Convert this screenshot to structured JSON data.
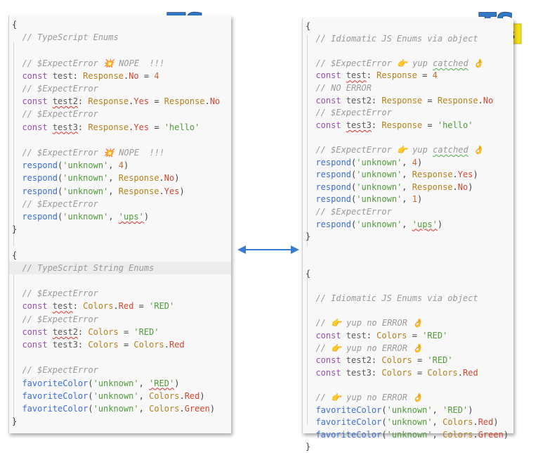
{
  "logos": {
    "ts": "TS",
    "tsjs_ts": "TS",
    "tsjs_js": "JS"
  },
  "left_panel": {
    "lines": [
      [
        [
          "pl",
          "{"
        ]
      ],
      [
        [
          "cm",
          "  // TypeScript Enums"
        ]
      ],
      [],
      [
        [
          "cm",
          "  // $ExpectError 💥 NOPE  !!!"
        ]
      ],
      [
        [
          "kw",
          "  const "
        ],
        [
          "vr",
          "test"
        ],
        [
          "pl",
          ": "
        ],
        [
          "ty",
          "Response"
        ],
        [
          "pl",
          "."
        ],
        [
          "pr",
          "No"
        ],
        [
          "pl",
          " = "
        ],
        [
          "nu",
          "4"
        ]
      ],
      [
        [
          "cm",
          "  // $ExpectError"
        ]
      ],
      [
        [
          "kw",
          "  const "
        ],
        [
          "vr sq",
          "test2"
        ],
        [
          "pl",
          ": "
        ],
        [
          "ty",
          "Response"
        ],
        [
          "pl",
          "."
        ],
        [
          "pr",
          "Yes"
        ],
        [
          "pl",
          " = "
        ],
        [
          "ty",
          "Response"
        ],
        [
          "pl",
          "."
        ],
        [
          "pr",
          "No"
        ]
      ],
      [
        [
          "cm",
          "  // $ExpectError"
        ]
      ],
      [
        [
          "kw",
          "  const "
        ],
        [
          "vr sq",
          "test3"
        ],
        [
          "pl",
          ": "
        ],
        [
          "ty",
          "Response"
        ],
        [
          "pl",
          "."
        ],
        [
          "pr",
          "Yes"
        ],
        [
          "pl",
          " = "
        ],
        [
          "st",
          "'hello'"
        ]
      ],
      [],
      [
        [
          "cm",
          "  // $ExpectError 💥 NOPE  !!!"
        ]
      ],
      [
        [
          "fn",
          "  respond"
        ],
        [
          "pl",
          "("
        ],
        [
          "st",
          "'unknown'"
        ],
        [
          "pl",
          ", "
        ],
        [
          "nu",
          "4"
        ],
        [
          "pl",
          ")"
        ]
      ],
      [
        [
          "fn",
          "  respond"
        ],
        [
          "pl",
          "("
        ],
        [
          "st",
          "'unknown'"
        ],
        [
          "pl",
          ", "
        ],
        [
          "ty",
          "Response"
        ],
        [
          "pl",
          "."
        ],
        [
          "pr",
          "No"
        ],
        [
          "pl",
          ")"
        ]
      ],
      [
        [
          "fn",
          "  respond"
        ],
        [
          "pl",
          "("
        ],
        [
          "st",
          "'unknown'"
        ],
        [
          "pl",
          ", "
        ],
        [
          "ty",
          "Response"
        ],
        [
          "pl",
          "."
        ],
        [
          "pr",
          "Yes"
        ],
        [
          "pl",
          ")"
        ]
      ],
      [
        [
          "cm",
          "  // $ExpectError"
        ]
      ],
      [
        [
          "fn",
          "  respond"
        ],
        [
          "pl",
          "("
        ],
        [
          "st",
          "'unknown'"
        ],
        [
          "pl",
          ", "
        ],
        [
          "st sq",
          "'ups'"
        ],
        [
          "pl",
          ")"
        ]
      ],
      [
        [
          "pl",
          "}"
        ]
      ],
      [],
      [
        [
          "pl",
          "{"
        ]
      ],
      [
        [
          "cm",
          "  // TypeScript String Enums"
        ]
      ],
      [],
      [
        [
          "cm",
          "  // $ExpectError"
        ]
      ],
      [
        [
          "kw",
          "  const "
        ],
        [
          "vr sq",
          "test"
        ],
        [
          "pl",
          ": "
        ],
        [
          "ty",
          "Colors"
        ],
        [
          "pl",
          "."
        ],
        [
          "pr",
          "Red"
        ],
        [
          "pl",
          " = "
        ],
        [
          "st",
          "'RED'"
        ]
      ],
      [
        [
          "cm",
          "  // $ExpectError"
        ]
      ],
      [
        [
          "kw",
          "  const "
        ],
        [
          "vr sq",
          "test2"
        ],
        [
          "pl",
          ": "
        ],
        [
          "ty",
          "Colors"
        ],
        [
          "pl",
          " = "
        ],
        [
          "st",
          "'RED'"
        ]
      ],
      [
        [
          "kw",
          "  const "
        ],
        [
          "vr",
          "test3"
        ],
        [
          "pl",
          ": "
        ],
        [
          "ty",
          "Colors"
        ],
        [
          "pl",
          " = "
        ],
        [
          "ty",
          "Colors"
        ],
        [
          "pl",
          "."
        ],
        [
          "pr",
          "Red"
        ]
      ],
      [],
      [
        [
          "cm",
          "  // $ExpectError"
        ]
      ],
      [
        [
          "fn",
          "  favoriteColor"
        ],
        [
          "pl",
          "("
        ],
        [
          "st",
          "'unknown'"
        ],
        [
          "pl",
          ", "
        ],
        [
          "st sq",
          "'RED'"
        ],
        [
          "pl",
          ")"
        ]
      ],
      [
        [
          "fn",
          "  favoriteColor"
        ],
        [
          "pl",
          "("
        ],
        [
          "st",
          "'unknown'"
        ],
        [
          "pl",
          ", "
        ],
        [
          "ty",
          "Colors"
        ],
        [
          "pl",
          "."
        ],
        [
          "pr",
          "Red"
        ],
        [
          "pl",
          ")"
        ]
      ],
      [
        [
          "fn",
          "  favoriteColor"
        ],
        [
          "pl",
          "("
        ],
        [
          "st",
          "'unknown'"
        ],
        [
          "pl",
          ", "
        ],
        [
          "ty",
          "Colors"
        ],
        [
          "pl",
          "."
        ],
        [
          "pr",
          "Green"
        ],
        [
          "pl",
          ")"
        ]
      ],
      [
        [
          "pl",
          "}"
        ]
      ]
    ]
  },
  "right_panel": {
    "lines": [
      [
        [
          "pl",
          "{"
        ]
      ],
      [
        [
          "cm",
          "  // Idiomatic JS Enums via object"
        ]
      ],
      [],
      [
        [
          "cm",
          "  // $ExpectError 👉 yup "
        ],
        [
          "cm sqg",
          "catched"
        ],
        [
          "cm",
          " 👌"
        ]
      ],
      [
        [
          "kw",
          "  const "
        ],
        [
          "vr sq",
          "test"
        ],
        [
          "pl",
          ": "
        ],
        [
          "ty",
          "Response"
        ],
        [
          "pl",
          " = "
        ],
        [
          "nu",
          "4"
        ]
      ],
      [
        [
          "cm",
          "  // NO ERROR"
        ]
      ],
      [
        [
          "kw",
          "  const "
        ],
        [
          "vr",
          "test2"
        ],
        [
          "pl",
          ": "
        ],
        [
          "ty",
          "Response"
        ],
        [
          "pl",
          " = "
        ],
        [
          "ty",
          "Response"
        ],
        [
          "pl",
          "."
        ],
        [
          "pr",
          "No"
        ]
      ],
      [
        [
          "cm",
          "  // $ExpectError"
        ]
      ],
      [
        [
          "kw",
          "  const "
        ],
        [
          "vr sq",
          "test3"
        ],
        [
          "pl",
          ": "
        ],
        [
          "ty",
          "Response"
        ],
        [
          "pl",
          " = "
        ],
        [
          "st",
          "'hello'"
        ]
      ],
      [],
      [
        [
          "cm",
          "  // $ExpectError 👉 yup "
        ],
        [
          "cm sqg",
          "catched"
        ],
        [
          "cm",
          " 👌"
        ]
      ],
      [
        [
          "fn",
          "  respond"
        ],
        [
          "pl",
          "("
        ],
        [
          "st",
          "'unknown'"
        ],
        [
          "pl",
          ", "
        ],
        [
          "nu",
          "4"
        ],
        [
          "pl",
          ")"
        ]
      ],
      [
        [
          "fn",
          "  respond"
        ],
        [
          "pl",
          "("
        ],
        [
          "st",
          "'unknown'"
        ],
        [
          "pl",
          ", "
        ],
        [
          "ty",
          "Response"
        ],
        [
          "pl",
          "."
        ],
        [
          "pr",
          "Yes"
        ],
        [
          "pl",
          ")"
        ]
      ],
      [
        [
          "fn",
          "  respond"
        ],
        [
          "pl",
          "("
        ],
        [
          "st",
          "'unknown'"
        ],
        [
          "pl",
          ", "
        ],
        [
          "ty",
          "Response"
        ],
        [
          "pl",
          "."
        ],
        [
          "pr",
          "No"
        ],
        [
          "pl",
          ")"
        ]
      ],
      [
        [
          "fn",
          "  respond"
        ],
        [
          "pl",
          "("
        ],
        [
          "st",
          "'unknown'"
        ],
        [
          "pl",
          ", "
        ],
        [
          "nu",
          "1"
        ],
        [
          "pl",
          ")"
        ]
      ],
      [
        [
          "cm",
          "  // $ExpectError"
        ]
      ],
      [
        [
          "fn",
          "  respond"
        ],
        [
          "pl",
          "("
        ],
        [
          "st",
          "'unknown'"
        ],
        [
          "pl",
          ", "
        ],
        [
          "st sq",
          "'ups'"
        ],
        [
          "pl",
          ")"
        ]
      ],
      [
        [
          "pl",
          "}"
        ]
      ],
      [],
      [],
      [
        [
          "pl",
          "{"
        ]
      ],
      [],
      [
        [
          "cm",
          "  // Idiomatic JS Enums via object"
        ]
      ],
      [],
      [
        [
          "cm",
          "  // 👉 yup no ERROR 👌"
        ]
      ],
      [
        [
          "kw",
          "  const "
        ],
        [
          "vr",
          "test"
        ],
        [
          "pl",
          ": "
        ],
        [
          "ty",
          "Colors"
        ],
        [
          "pl",
          " = "
        ],
        [
          "st",
          "'RED'"
        ]
      ],
      [
        [
          "cm",
          "  // 👉 yup no ERROR 👌"
        ]
      ],
      [
        [
          "kw",
          "  const "
        ],
        [
          "vr",
          "test2"
        ],
        [
          "pl",
          ": "
        ],
        [
          "ty",
          "Colors"
        ],
        [
          "pl",
          " = "
        ],
        [
          "st",
          "'RED'"
        ]
      ],
      [
        [
          "kw",
          "  const "
        ],
        [
          "vr",
          "test3"
        ],
        [
          "pl",
          ": "
        ],
        [
          "ty",
          "Colors"
        ],
        [
          "pl",
          " = "
        ],
        [
          "ty",
          "Colors"
        ],
        [
          "pl",
          "."
        ],
        [
          "pr",
          "Red"
        ]
      ],
      [],
      [
        [
          "cm",
          "  // 👉 yup no ERROR 👌"
        ]
      ],
      [
        [
          "fn",
          "  favoriteColor"
        ],
        [
          "pl",
          "("
        ],
        [
          "st",
          "'unknown'"
        ],
        [
          "pl",
          ", "
        ],
        [
          "st",
          "'RED'"
        ],
        [
          "pl",
          ")"
        ]
      ],
      [
        [
          "fn",
          "  favoriteColor"
        ],
        [
          "pl",
          "("
        ],
        [
          "st",
          "'unknown'"
        ],
        [
          "pl",
          ", "
        ],
        [
          "ty",
          "Colors"
        ],
        [
          "pl",
          "."
        ],
        [
          "pr",
          "Red"
        ],
        [
          "pl",
          ")"
        ]
      ],
      [
        [
          "fn",
          "  favoriteColor"
        ],
        [
          "pl",
          "("
        ],
        [
          "st",
          "'unknown'"
        ],
        [
          "pl",
          ", "
        ],
        [
          "ty",
          "Colors"
        ],
        [
          "pl",
          "."
        ],
        [
          "pr",
          "Green"
        ],
        [
          "pl",
          ")"
        ]
      ],
      [
        [
          "pl",
          "}"
        ]
      ]
    ]
  },
  "colors": {
    "ts_blue": "#3178c6",
    "js_yellow": "#f7df1e",
    "arrow": "#3a7bd5"
  }
}
